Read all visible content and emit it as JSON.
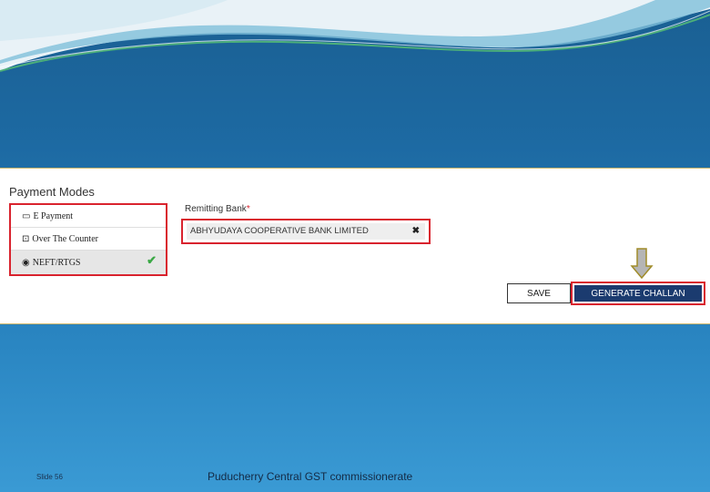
{
  "panel": {
    "payment_modes_title": "Payment Modes",
    "modes": [
      {
        "label": "E Payment",
        "icon": "card-icon",
        "selected": false
      },
      {
        "label": "Over The Counter",
        "icon": "counter-icon",
        "selected": false
      },
      {
        "label": "NEFT/RTGS",
        "icon": "radio-icon",
        "selected": true
      }
    ],
    "selected_check": "check-icon",
    "remitting_bank_label": "Remitting Bank",
    "required_marker": "*",
    "remitting_bank_value": "ABHYUDAYA COOPERATIVE BANK LIMITED",
    "clear_symbol": "✖",
    "save_label": "SAVE",
    "generate_label": "GENERATE CHALLAN"
  },
  "footer": {
    "slide_label": "Slide 56",
    "organisation": "Puducherry Central GST commissionerate"
  },
  "colors": {
    "highlight": "#d9232e",
    "primary_button": "#1b3b6f",
    "check": "#3aa845",
    "arrow": "#b5b5b5",
    "arrow_outline": "#a08c2a"
  }
}
